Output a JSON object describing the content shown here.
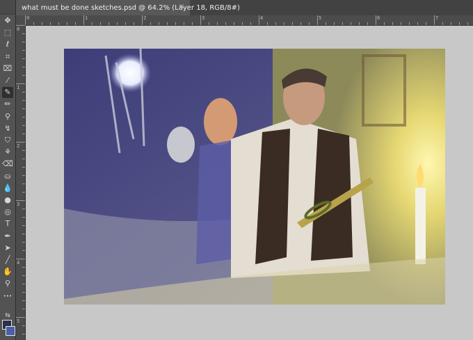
{
  "document": {
    "tab_title": "what must be done sketches.psd @ 64.2% (Layer 18, RGB/8#)",
    "close_glyph": "×"
  },
  "toolbar": {
    "tools": [
      {
        "name": "move-tool-icon",
        "glyph": "✥"
      },
      {
        "name": "marquee-tool-icon",
        "glyph": "⬚"
      },
      {
        "name": "lasso-tool-icon",
        "glyph": "ℓ"
      },
      {
        "name": "quick-select-tool-icon",
        "glyph": "⌗"
      },
      {
        "name": "crop-tool-icon",
        "glyph": "⌧"
      },
      {
        "name": "eyedropper-tool-icon",
        "glyph": "⁄"
      },
      {
        "name": "brush-tool-icon",
        "glyph": "✎",
        "active": true
      },
      {
        "name": "pencil-tool-icon",
        "glyph": "✏"
      },
      {
        "name": "clone-stamp-tool-icon",
        "glyph": "⚲"
      },
      {
        "name": "history-brush-tool-icon",
        "glyph": "↯"
      },
      {
        "name": "stamp-tool-icon",
        "glyph": "⛉"
      },
      {
        "name": "mixer-brush-tool-icon",
        "glyph": "⚘"
      },
      {
        "name": "eraser-tool-icon",
        "glyph": "⌫"
      },
      {
        "name": "paint-bucket-tool-icon",
        "glyph": "⛀"
      },
      {
        "name": "blur-tool-icon",
        "glyph": "💧"
      },
      {
        "name": "dodge-tool-icon",
        "glyph": "●"
      },
      {
        "name": "sponge-tool-icon",
        "glyph": "◎"
      },
      {
        "name": "type-tool-icon",
        "glyph": "T"
      },
      {
        "name": "pen-tool-icon",
        "glyph": "✒"
      },
      {
        "name": "path-select-tool-icon",
        "glyph": "➤"
      },
      {
        "name": "line-tool-icon",
        "glyph": "╱"
      },
      {
        "name": "hand-tool-icon",
        "glyph": "✋"
      },
      {
        "name": "zoom-tool-icon",
        "glyph": "⚲"
      },
      {
        "name": "more-tools-icon",
        "glyph": "•••"
      }
    ],
    "foreground_color": "#2b2f4a",
    "background_color": "#4a5fa8"
  },
  "rulers": {
    "top_labels": [
      "0",
      "1",
      "2",
      "3",
      "4",
      "5",
      "6",
      "7"
    ],
    "left_labels": [
      "0",
      "1",
      "2",
      "3",
      "4",
      "5"
    ]
  },
  "colors": {
    "chrome": "#535353",
    "tab_active": "#585858",
    "pasteboard": "#c8c8c8",
    "accent_blue": "#4a5fa8",
    "candle_glow": "#f2e06a"
  }
}
